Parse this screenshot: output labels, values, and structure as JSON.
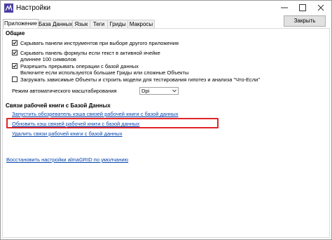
{
  "window": {
    "title": "Настройки"
  },
  "tabs": [
    {
      "label": "Приложение",
      "active": true
    },
    {
      "label": "База Данных",
      "active": false
    },
    {
      "label": "Язык",
      "active": false
    },
    {
      "label": "Теги",
      "active": false
    },
    {
      "label": "Гриды",
      "active": false
    },
    {
      "label": "Макросы",
      "active": false
    }
  ],
  "close_button_label": "Закрыть",
  "general": {
    "title": "Общие",
    "options": [
      {
        "lines": [
          "Скрывать панели инструментов при выборе другого приложения"
        ],
        "checked": true
      },
      {
        "lines": [
          "Скрывать панель формулы если текст в активной ячейке",
          "длиннее 100 символов"
        ],
        "checked": true
      },
      {
        "lines": [
          "Разрешить прерывать операции с базой данных",
          "Включите если используются большие Гриды или сложные Объекты"
        ],
        "checked": true
      },
      {
        "lines": [
          "Загружать зависимые Объекты и строить модели для тестирования гипотез и анализа \"Что-Если\""
        ],
        "checked": false
      }
    ],
    "scaling_label": "Режим автоматического масштабирования",
    "scaling_value": "Dpi"
  },
  "links_group": {
    "title": "Связи рабочей книги с Базой Данных",
    "links": [
      "Запустить обозреватель кэша связей рабочей книги с базой данных",
      "Обновить кэш связей рабочей книги с базой данных",
      "Удалить связи рабочей книги с базой данных"
    ],
    "highlighted_index": 1
  },
  "reset_link": "Восстановить настройки almaGRID по умолчанию",
  "colors": {
    "link": "#0645ad",
    "highlight": "#e0262a"
  }
}
